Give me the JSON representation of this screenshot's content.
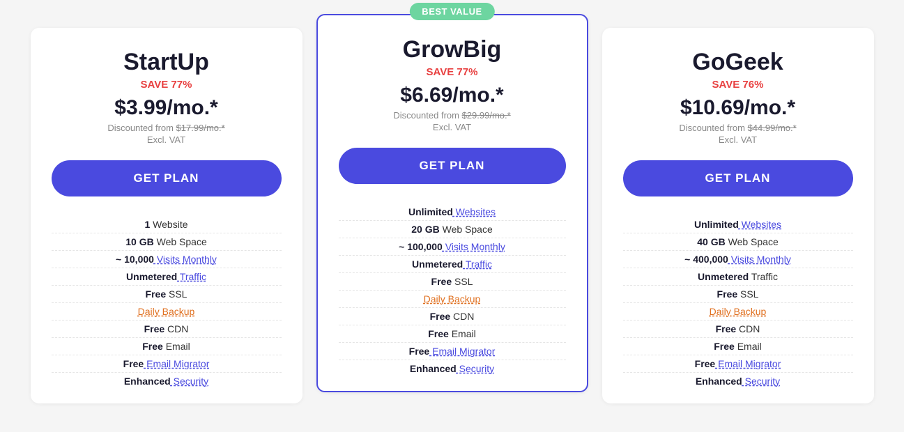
{
  "plans": [
    {
      "id": "startup",
      "name": "StartUp",
      "save": "SAVE 77%",
      "price": "$3.99/mo.*",
      "original_price": "$17.99/mo.*",
      "discounted_from": "Discounted from",
      "excl_vat": "Excl. VAT",
      "cta": "GET PLAN",
      "featured": false,
      "best_value": false,
      "features": [
        {
          "bold": "1",
          "text": " Website",
          "style": "normal"
        },
        {
          "bold": "10 GB",
          "text": " Web Space",
          "style": "normal"
        },
        {
          "bold": "~ 10,000",
          "text": " Visits Monthly",
          "style": "link"
        },
        {
          "bold": "Unmetered",
          "text": " Traffic",
          "style": "link"
        },
        {
          "bold": "Free",
          "text": " SSL",
          "style": "normal"
        },
        {
          "bold": "Daily Backup",
          "text": "",
          "style": "orange"
        },
        {
          "bold": "Free",
          "text": " CDN",
          "style": "normal"
        },
        {
          "bold": "Free",
          "text": " Email",
          "style": "normal"
        },
        {
          "bold": "Free",
          "text": " Email Migrator",
          "style": "link"
        },
        {
          "bold": "Enhanced",
          "text": " Security",
          "style": "link"
        }
      ]
    },
    {
      "id": "growbig",
      "name": "GrowBig",
      "save": "SAVE 77%",
      "price": "$6.69/mo.*",
      "original_price": "$29.99/mo.*",
      "discounted_from": "Discounted from",
      "excl_vat": "Excl. VAT",
      "cta": "GET PLAN",
      "featured": true,
      "best_value": true,
      "best_value_label": "BEST VALUE",
      "features": [
        {
          "bold": "Unlimited",
          "text": " Websites",
          "style": "link"
        },
        {
          "bold": "20 GB",
          "text": " Web Space",
          "style": "normal"
        },
        {
          "bold": "~ 100,000",
          "text": " Visits Monthly",
          "style": "link"
        },
        {
          "bold": "Unmetered",
          "text": " Traffic",
          "style": "link"
        },
        {
          "bold": "Free",
          "text": " SSL",
          "style": "normal"
        },
        {
          "bold": "Daily Backup",
          "text": "",
          "style": "orange"
        },
        {
          "bold": "Free",
          "text": " CDN",
          "style": "normal"
        },
        {
          "bold": "Free",
          "text": " Email",
          "style": "normal"
        },
        {
          "bold": "Free",
          "text": " Email Migrator",
          "style": "link"
        },
        {
          "bold": "Enhanced",
          "text": " Security",
          "style": "link"
        }
      ]
    },
    {
      "id": "gogeek",
      "name": "GoGeek",
      "save": "SAVE 76%",
      "price": "$10.69/mo.*",
      "original_price": "$44.99/mo.*",
      "discounted_from": "Discounted from",
      "excl_vat": "Excl. VAT",
      "cta": "GET PLAN",
      "featured": false,
      "best_value": false,
      "features": [
        {
          "bold": "Unlimited",
          "text": " Websites",
          "style": "link"
        },
        {
          "bold": "40 GB",
          "text": " Web Space",
          "style": "normal"
        },
        {
          "bold": "~ 400,000",
          "text": " Visits Monthly",
          "style": "link"
        },
        {
          "bold": "Unmetered",
          "text": " Traffic",
          "style": "normal"
        },
        {
          "bold": "Free",
          "text": " SSL",
          "style": "normal"
        },
        {
          "bold": "Daily Backup",
          "text": "",
          "style": "orange"
        },
        {
          "bold": "Free",
          "text": " CDN",
          "style": "normal"
        },
        {
          "bold": "Free",
          "text": " Email",
          "style": "normal"
        },
        {
          "bold": "Free",
          "text": " Email Migrator",
          "style": "link"
        },
        {
          "bold": "Enhanced",
          "text": " Security",
          "style": "link"
        }
      ]
    }
  ]
}
